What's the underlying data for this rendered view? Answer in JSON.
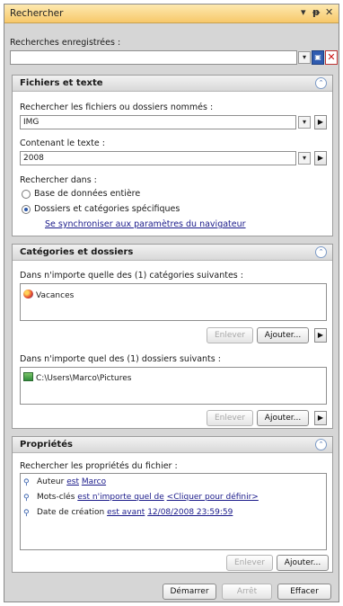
{
  "title": "Rechercher",
  "saved_searches": {
    "label": "Recherches enregistrées :",
    "value": ""
  },
  "files_panel": {
    "title": "Fichiers et texte",
    "names_label": "Rechercher les fichiers ou dossiers nommés :",
    "names_value": "IMG",
    "text_label": "Contenant le texte :",
    "text_value": "2008",
    "search_in_label": "Rechercher dans :",
    "options": [
      "Base de données entière",
      "Dossiers et catégories spécifiques"
    ],
    "sync_link": "Se synchroniser aux paramètres du navigateur"
  },
  "cat_panel": {
    "title": "Catégories et dossiers",
    "cat_label": "Dans n'importe quelle des (1) catégories suivantes :",
    "categories": [
      "Vacances"
    ],
    "folders_label": "Dans n'importe quel des (1) dossiers suivants :",
    "folders": [
      "C:\\Users\\Marco\\Pictures"
    ],
    "remove": "Enlever",
    "add": "Ajouter..."
  },
  "props_panel": {
    "title": "Propriétés",
    "label": "Rechercher les propriétés du fichier :",
    "rows": [
      {
        "name": "Auteur",
        "op": "est",
        "value": "Marco"
      },
      {
        "name": "Mots-clés",
        "op": "est n'importe quel de",
        "value": "<Cliquer pour définir>"
      },
      {
        "name": "Date de création",
        "op": "est avant",
        "value": "12/08/2008 23:59:59"
      }
    ],
    "remove": "Enlever",
    "add": "Ajouter..."
  },
  "footer": {
    "start": "Démarrer",
    "stop": "Arrêt",
    "clear": "Effacer"
  },
  "colors": {
    "title_bar": "#f7c86a",
    "panel_header": "#e2e2e2",
    "accent": "#2c58a8"
  }
}
